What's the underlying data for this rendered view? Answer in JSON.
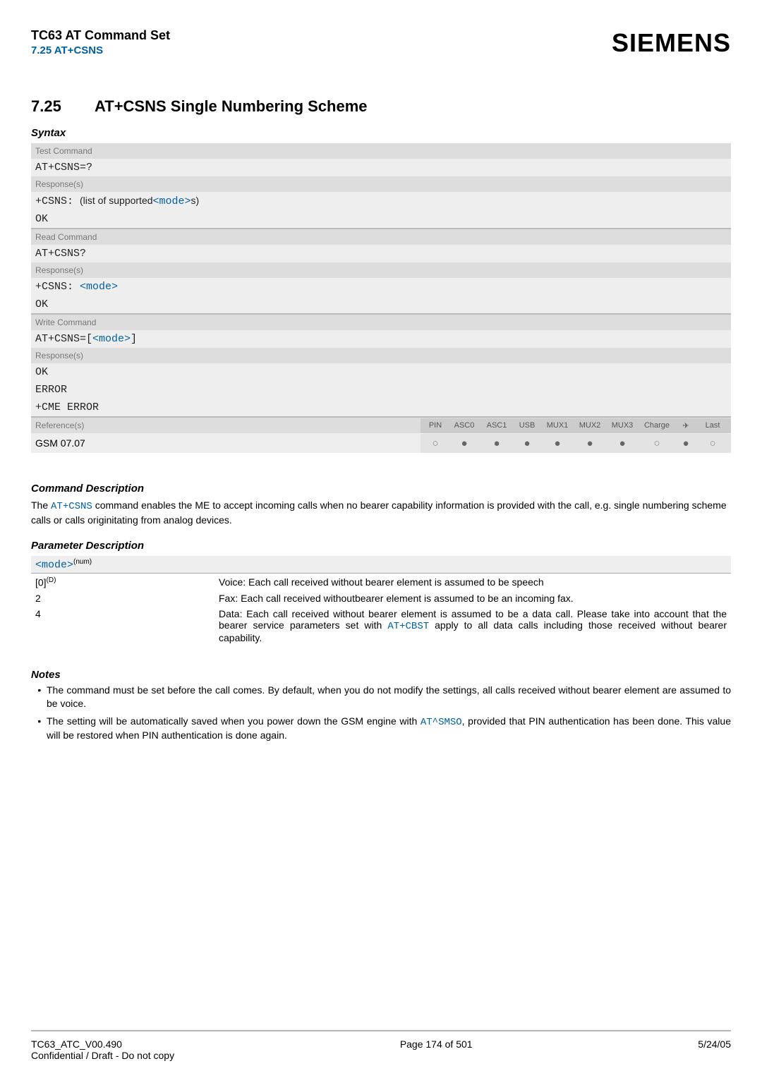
{
  "header": {
    "title": "TC63 AT Command Set",
    "subtitle": "7.25 AT+CSNS",
    "logo": "SIEMENS"
  },
  "section": {
    "number": "7.25",
    "title": "AT+CSNS   Single Numbering Scheme"
  },
  "syntax": {
    "label": "Syntax",
    "test_label": "Test Command",
    "test_cmd": "AT+CSNS=?",
    "resp_label": "Response(s)",
    "test_resp_prefix": "+CSNS: ",
    "test_resp_mid": "(list of supported",
    "test_resp_link": "<mode>",
    "test_resp_suffix": "s)",
    "ok": "OK",
    "read_label": "Read Command",
    "read_cmd": "AT+CSNS?",
    "read_resp_prefix": "+CSNS: ",
    "read_resp_link": "<mode>",
    "write_label": "Write Command",
    "write_cmd_prefix": "AT+CSNS=[",
    "write_cmd_link": "<mode>",
    "write_cmd_suffix": "]",
    "error": "ERROR",
    "cme": "+CME ERROR",
    "refs_label": "Reference(s)",
    "refs_value": "GSM 07.07",
    "cols": {
      "pin": "PIN",
      "asc0": "ASC0",
      "asc1": "ASC1",
      "usb": "USB",
      "mux1": "MUX1",
      "mux2": "MUX2",
      "mux3": "MUX3",
      "charge": "Charge",
      "plane": "✈",
      "last": "Last"
    },
    "dots": {
      "pin": "○",
      "asc0": "●",
      "asc1": "●",
      "usb": "●",
      "mux1": "●",
      "mux2": "●",
      "mux3": "●",
      "charge": "○",
      "plane": "●",
      "last": "○"
    }
  },
  "cmddesc": {
    "label": "Command Description",
    "text_pre": "The ",
    "text_link": "AT+CSNS",
    "text_post": " command enables the ME to accept incoming calls when no bearer capability information is provided with the call, e.g. single numbering scheme calls or calls originitating from analog devices."
  },
  "params": {
    "label": "Parameter Description",
    "head_link": "<mode>",
    "head_sup": "(num)",
    "rows": [
      {
        "key_pre": "[0]",
        "key_sup": "(D)",
        "val": "Voice: Each call received without bearer element is assumed to be speech"
      },
      {
        "key_pre": "2",
        "key_sup": "",
        "val": "Fax: Each call received withoutbearer element is assumed to be an incoming fax."
      },
      {
        "key_pre": "4",
        "key_sup": "",
        "val_pre": "Data: Each call received without bearer element is assumed to be a data call. Please take into account that the bearer service parameters set with ",
        "val_link": "AT+CBST",
        "val_post": " apply to all data calls including those received without bearer capability."
      }
    ]
  },
  "notes": {
    "label": "Notes",
    "items": [
      {
        "pre": "The command must be set before the call comes. By default, when you do not modify the settings, all calls received without bearer element are assumed to be voice."
      },
      {
        "pre": "The setting will be automatically saved when you power down the GSM engine with ",
        "link": "AT^SMSO",
        "post": ", provided that PIN authentication has been done. This value will be restored when PIN authentication is done again."
      }
    ]
  },
  "footer": {
    "doc": "TC63_ATC_V00.490",
    "conf": "Confidential / Draft - Do not copy",
    "page": "Page 174 of 501",
    "date": "5/24/05"
  }
}
